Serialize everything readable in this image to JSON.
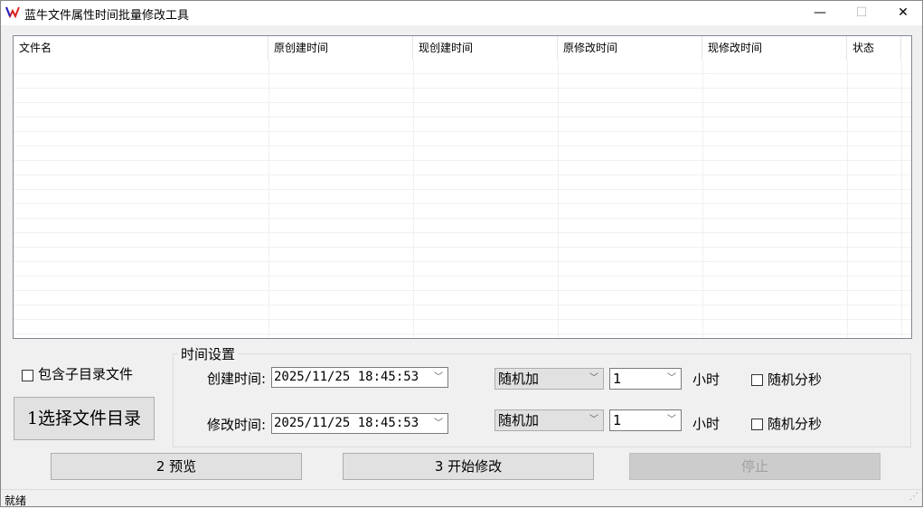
{
  "window": {
    "title": "蓝牛文件属性时间批量修改工具",
    "minimize": "—",
    "maximize": "☐",
    "close": "✕"
  },
  "table": {
    "columns": [
      "文件名",
      "原创建时间",
      "现创建时间",
      "原修改时间",
      "现修改时间",
      "状态"
    ],
    "rows": []
  },
  "options": {
    "include_subdirs_label": "包含子目录文件",
    "include_subdirs_checked": false,
    "select_dir_button": "1选择文件目录"
  },
  "time_settings": {
    "legend": "时间设置",
    "create": {
      "label": "创建时间:",
      "value": "2025/11/25 18:45:53",
      "mode": "随机加",
      "amount": "1",
      "unit": "小时",
      "random_ms_label": "随机分秒",
      "random_ms_checked": false
    },
    "modify": {
      "label": "修改时间:",
      "value": "2025/11/25 18:45:53",
      "mode": "随机加",
      "amount": "1",
      "unit": "小时",
      "random_ms_label": "随机分秒",
      "random_ms_checked": false
    }
  },
  "buttons": {
    "preview": "2 预览",
    "start": "3 开始修改",
    "stop": "停止"
  },
  "status": "就绪"
}
